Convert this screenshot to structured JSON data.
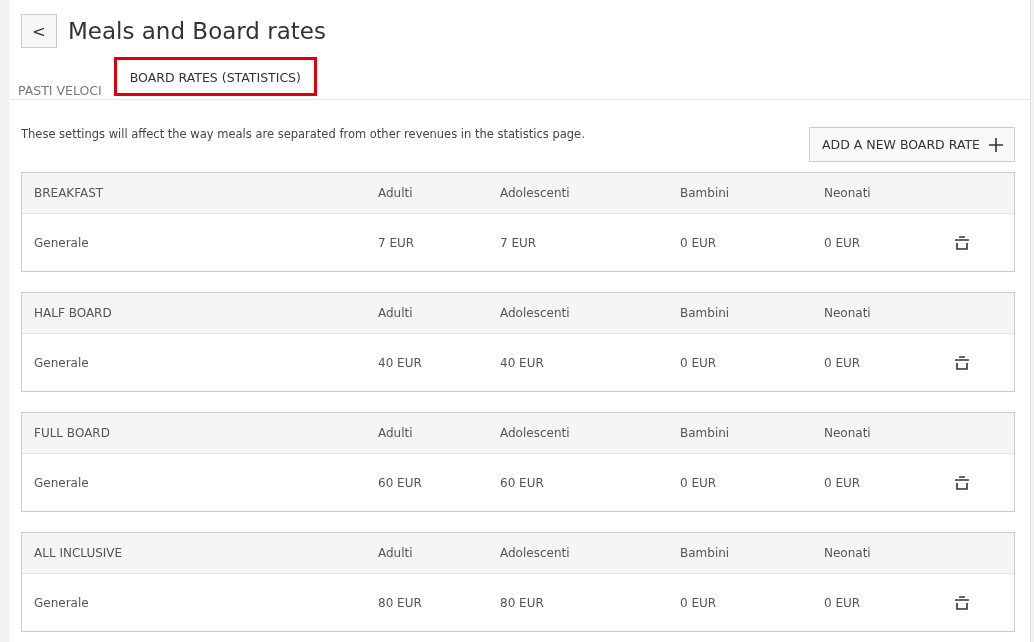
{
  "header": {
    "back": "<",
    "title": "Meals and Board rates"
  },
  "tabs": [
    {
      "label": "PASTI VELOCI",
      "selected": false,
      "highlighted": false
    },
    {
      "label": "BOARD RATES (STATISTICS)",
      "selected": true,
      "highlighted": true
    }
  ],
  "description": "These settings will affect the way meals are separated from other revenues in the statistics page.",
  "add_button": "ADD A NEW BOARD RATE",
  "boards": [
    {
      "name": "BREAKFAST",
      "columns": [
        "Adulti",
        "Adolescenti",
        "Bambini",
        "Neonati"
      ],
      "rows": [
        {
          "label": "Generale",
          "values": [
            "7 EUR",
            "7 EUR",
            "0 EUR",
            "0 EUR"
          ]
        }
      ]
    },
    {
      "name": "HALF BOARD",
      "columns": [
        "Adulti",
        "Adolescenti",
        "Bambini",
        "Neonati"
      ],
      "rows": [
        {
          "label": "Generale",
          "values": [
            "40 EUR",
            "40 EUR",
            "0 EUR",
            "0 EUR"
          ]
        }
      ]
    },
    {
      "name": "FULL BOARD",
      "columns": [
        "Adulti",
        "Adolescenti",
        "Bambini",
        "Neonati"
      ],
      "rows": [
        {
          "label": "Generale",
          "values": [
            "60 EUR",
            "60 EUR",
            "0 EUR",
            "0 EUR"
          ]
        }
      ]
    },
    {
      "name": "ALL INCLUSIVE",
      "columns": [
        "Adulti",
        "Adolescenti",
        "Bambini",
        "Neonati"
      ],
      "rows": [
        {
          "label": "Generale",
          "values": [
            "80 EUR",
            "80 EUR",
            "0 EUR",
            "0 EUR"
          ]
        }
      ]
    }
  ]
}
